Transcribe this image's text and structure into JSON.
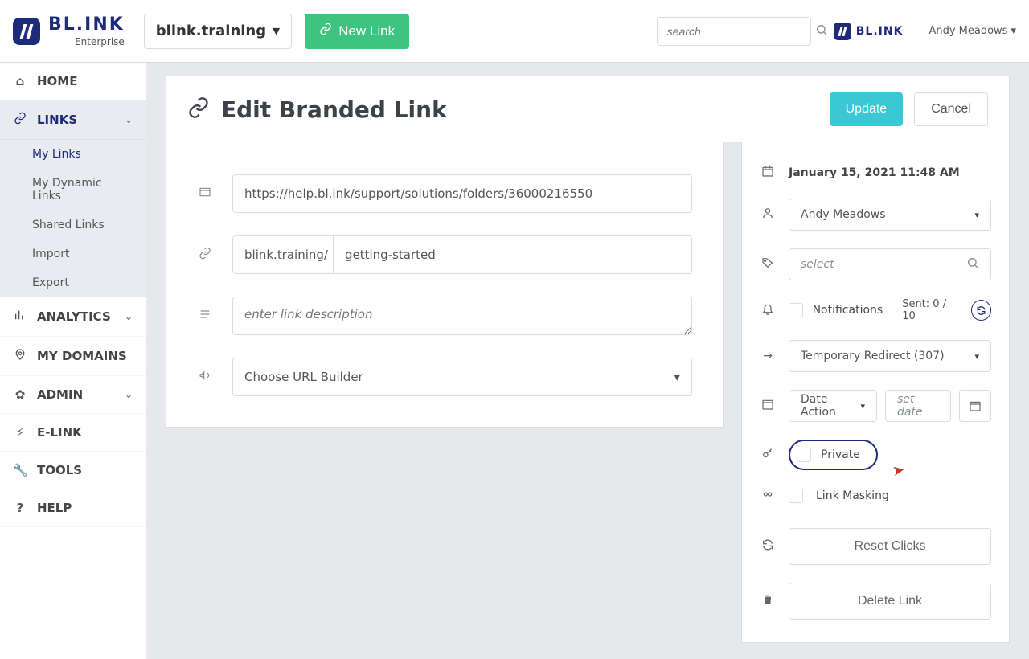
{
  "brand": {
    "name": "BL.INK",
    "suffix": "Enterprise"
  },
  "top": {
    "domain": "blink.training",
    "new_link": "New Link",
    "search_placeholder": "search",
    "user": "Andy Meadows"
  },
  "nav": {
    "home": "HOME",
    "links": "LINKS",
    "links_sub": {
      "my_links": "My Links",
      "dynamic": "My Dynamic Links",
      "shared": "Shared Links",
      "import": "Import",
      "export": "Export"
    },
    "analytics": "ANALYTICS",
    "domains": "MY DOMAINS",
    "admin": "ADMIN",
    "elink": "E-LINK",
    "tools": "TOOLS",
    "help": "HELP"
  },
  "page": {
    "title": "Edit Branded Link",
    "update": "Update",
    "cancel": "Cancel"
  },
  "form": {
    "destination": "https://help.bl.ink/support/solutions/folders/36000216550",
    "domain_prefix": "blink.training/",
    "slug": "getting-started",
    "description_placeholder": "enter link description",
    "builder": "Choose URL Builder"
  },
  "side": {
    "created": "January 15, 2021 11:48 AM",
    "owner": "Andy Meadows",
    "tags_placeholder": "select",
    "notifications": "Notifications",
    "sent": "Sent: 0 / 10",
    "redirect": "Temporary Redirect (307)",
    "date_action": "Date Action",
    "set_date_placeholder": "set date",
    "private": "Private",
    "masking": "Link Masking",
    "reset": "Reset Clicks",
    "delete": "Delete Link"
  }
}
